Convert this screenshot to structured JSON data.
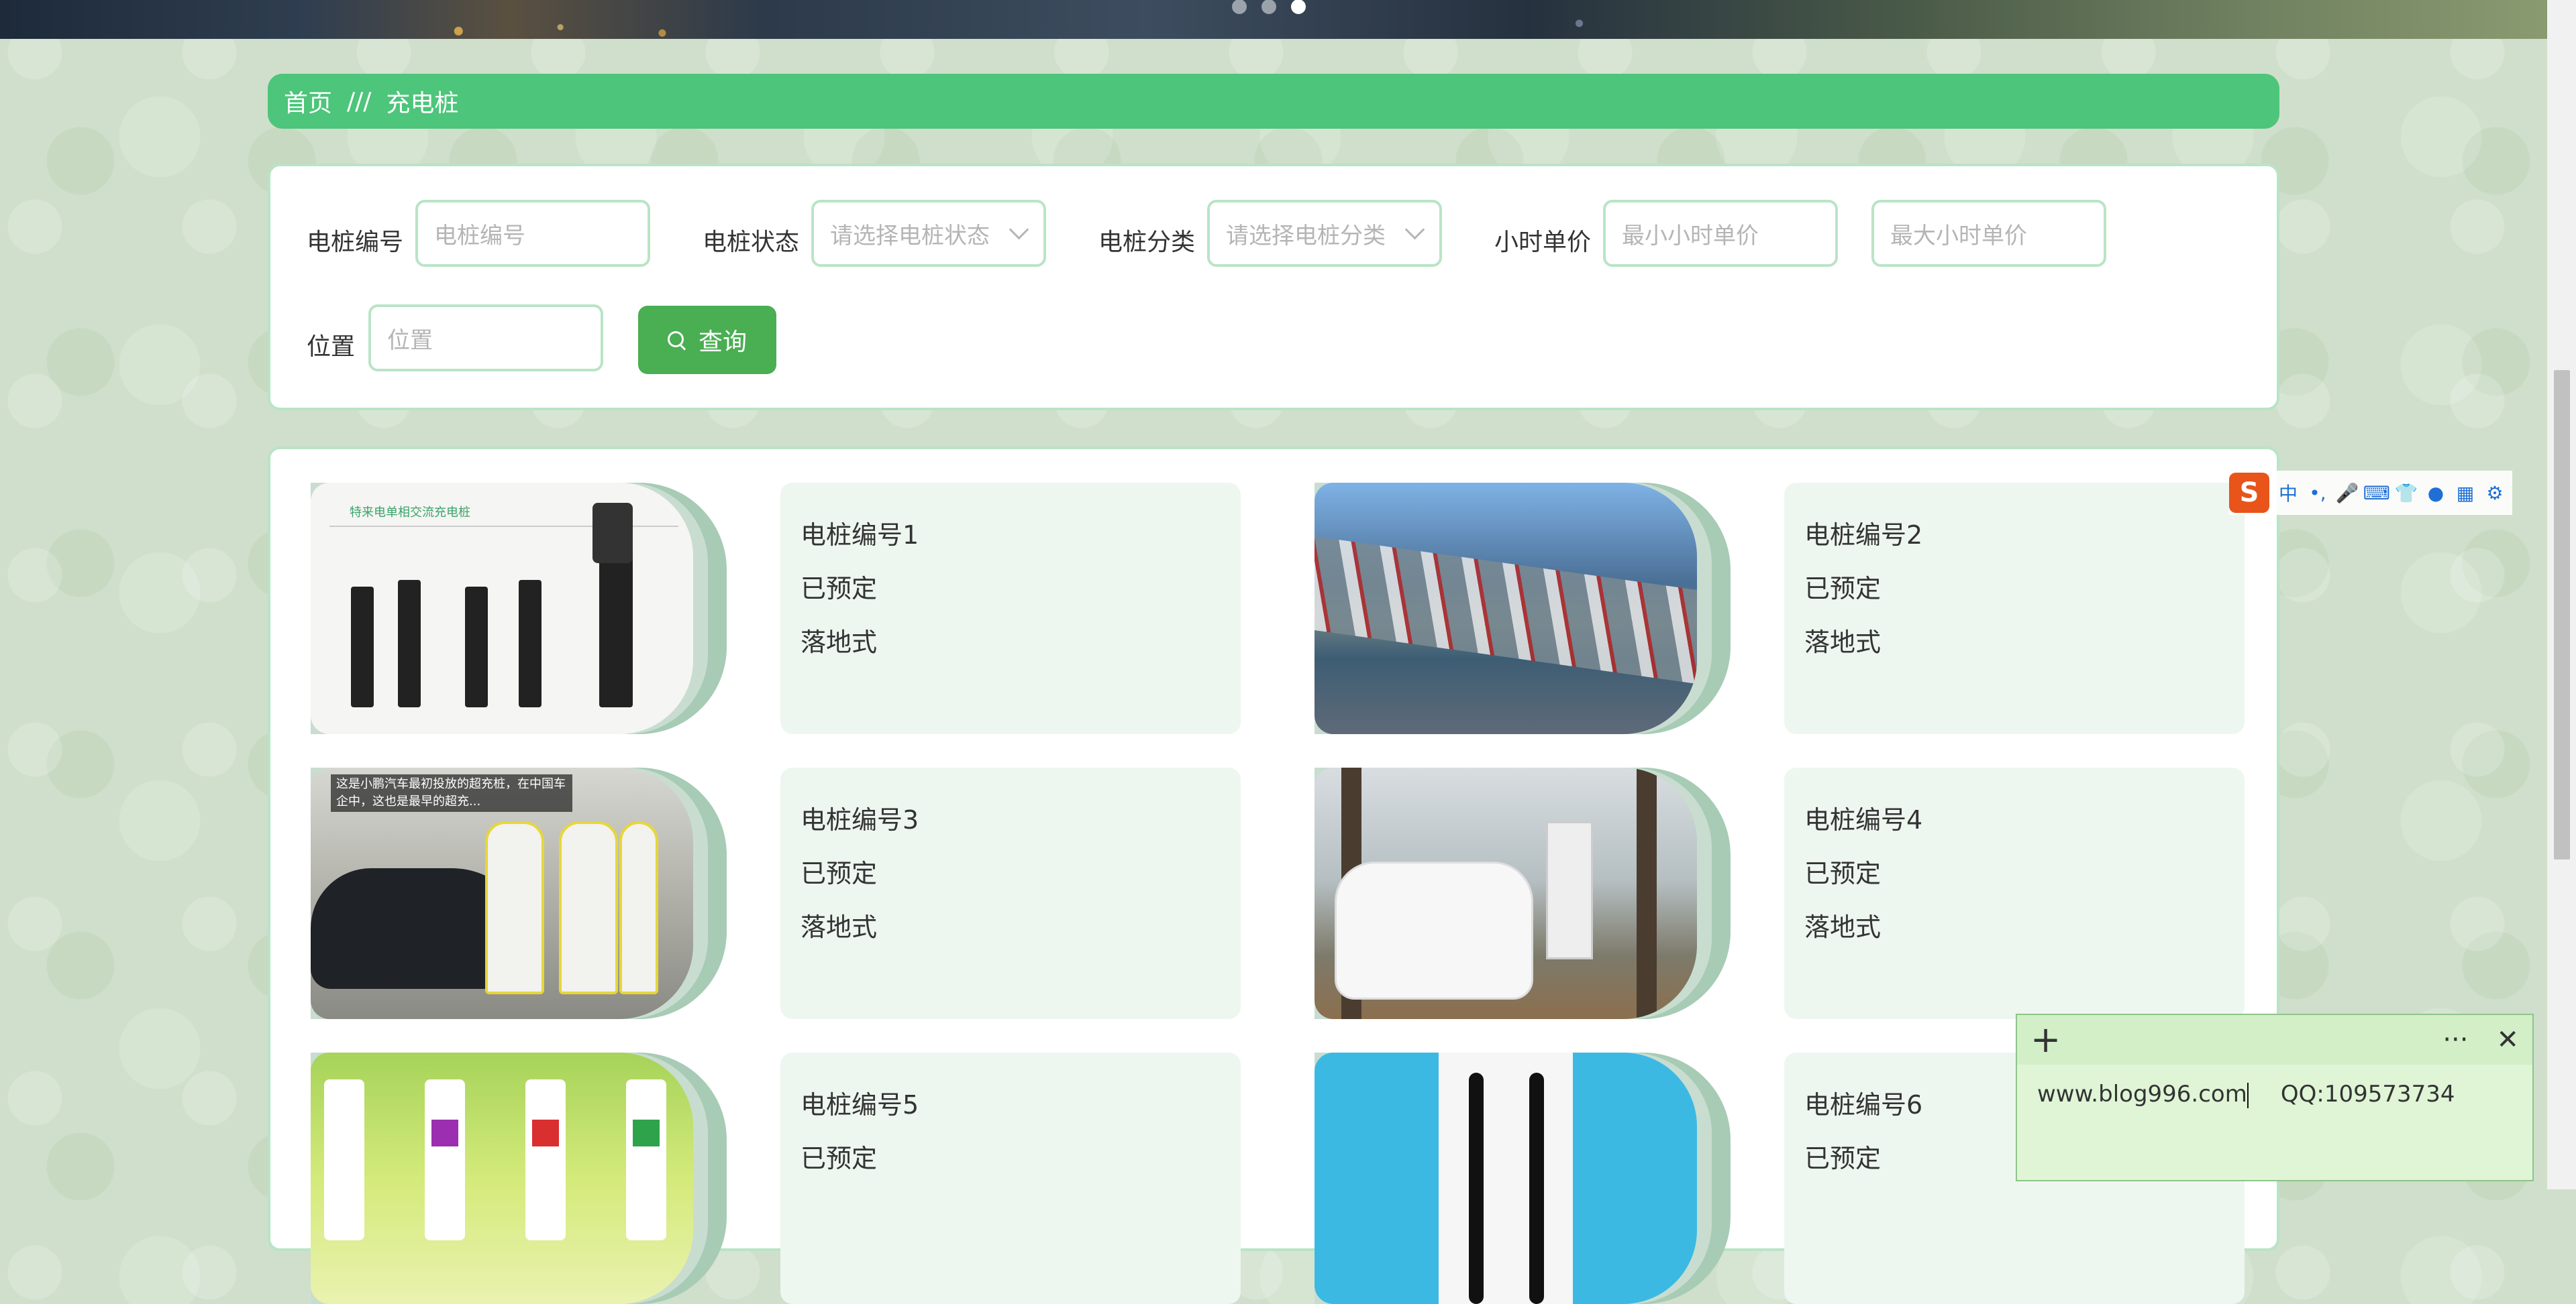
{
  "breadcrumb": {
    "home": "首页",
    "separator": "///",
    "current": "充电桩"
  },
  "search": {
    "pile_no": {
      "label": "电桩编号",
      "placeholder": "电桩编号"
    },
    "status": {
      "label": "电桩状态",
      "placeholder": "请选择电桩状态"
    },
    "category": {
      "label": "电桩分类",
      "placeholder": "请选择电桩分类"
    },
    "hourly_price": {
      "label": "小时单价",
      "min_placeholder": "最小小时单价",
      "max_placeholder": "最大小时单价"
    },
    "location": {
      "label": "位置",
      "placeholder": "位置"
    },
    "query_button": "查询"
  },
  "cards": [
    {
      "name": "电桩编号1",
      "status": "已预定",
      "type": "落地式",
      "image_caption": "特来电单相交流充电桩"
    },
    {
      "name": "电桩编号2",
      "status": "已预定",
      "type": "落地式"
    },
    {
      "name": "电桩编号3",
      "status": "已预定",
      "type": "落地式",
      "image_caption": "这是小鹏汽车最初投放的超充桩，在中国车企中，这也是最早的超充..."
    },
    {
      "name": "电桩编号4",
      "status": "已预定",
      "type": "落地式"
    },
    {
      "name": "电桩编号5",
      "status": "已预定"
    },
    {
      "name": "电桩编号6",
      "status": "已预定"
    }
  ],
  "ime_toolbar": {
    "logo": "S",
    "mode": "中",
    "punct": "•,",
    "icons": [
      "mic-icon",
      "keyboard-icon",
      "skin-icon",
      "robot-icon",
      "apps-icon",
      "settings-icon"
    ]
  },
  "note": {
    "url": "www.blog996.com",
    "qq": "QQ:109573734",
    "more": "···"
  },
  "colors": {
    "accent": "#4dc57a",
    "button": "#4aae52",
    "border": "#b9e4c6",
    "card_bg": "#eef6f0"
  }
}
